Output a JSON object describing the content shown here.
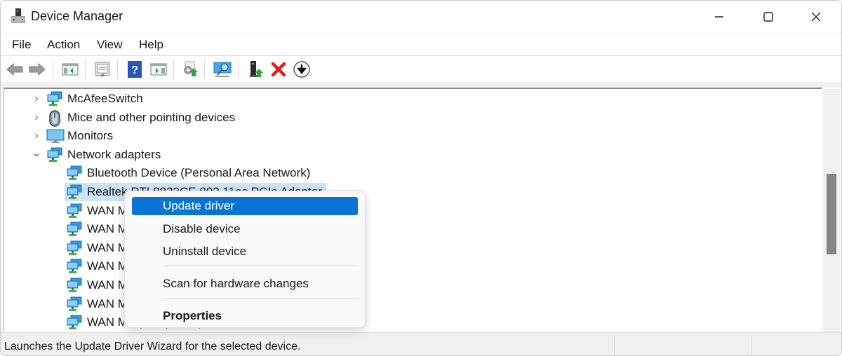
{
  "window": {
    "title": "Device Manager",
    "controls": {
      "minimize": "minimize",
      "maximize": "maximize",
      "close": "close"
    }
  },
  "menubar": {
    "items": [
      {
        "label": "File"
      },
      {
        "label": "Action"
      },
      {
        "label": "View"
      },
      {
        "label": "Help"
      }
    ]
  },
  "toolbar": {
    "buttons": [
      {
        "icon": "back-arrow-icon",
        "tooltip": "Back"
      },
      {
        "icon": "forward-arrow-icon",
        "tooltip": "Forward"
      },
      {
        "icon": "show-hide-console-tree-icon",
        "tooltip": "Show/Hide Console Tree"
      },
      {
        "icon": "properties-icon",
        "tooltip": "Properties"
      },
      {
        "icon": "help-icon",
        "tooltip": "Help"
      },
      {
        "icon": "show-hide-action-pane-icon",
        "tooltip": "Show/Hide Action Pane"
      },
      {
        "icon": "update-driver-icon",
        "tooltip": "Update Driver"
      },
      {
        "icon": "scan-hardware-icon",
        "tooltip": "Scan for hardware changes"
      },
      {
        "icon": "add-legacy-hardware-icon",
        "tooltip": "Add drivers"
      },
      {
        "icon": "uninstall-icon",
        "tooltip": "Uninstall device"
      },
      {
        "icon": "disable-device-icon",
        "tooltip": "Disable device"
      }
    ]
  },
  "tree": {
    "items": [
      {
        "label": "McAfeeSwitch",
        "level": 1,
        "expanded": false,
        "icon": "network-adapter-icon"
      },
      {
        "label": "Mice and other pointing devices",
        "level": 1,
        "expanded": false,
        "icon": "mouse-icon"
      },
      {
        "label": "Monitors",
        "level": 1,
        "expanded": false,
        "icon": "monitor-icon"
      },
      {
        "label": "Network adapters",
        "level": 1,
        "expanded": true,
        "icon": "network-adapter-icon"
      },
      {
        "label": "Bluetooth Device (Personal Area Network)",
        "level": 2,
        "icon": "network-adapter-icon"
      },
      {
        "label": "Realtek RTL8822CE 802.11ac PCIe Adapter",
        "level": 2,
        "icon": "network-adapter-icon",
        "selected": true
      },
      {
        "label": "WAN Miniport (IKEv2)",
        "level": 2,
        "icon": "network-adapter-icon"
      },
      {
        "label": "WAN Miniport (IP)",
        "level": 2,
        "icon": "network-adapter-icon"
      },
      {
        "label": "WAN Miniport (IPv6)",
        "level": 2,
        "icon": "network-adapter-icon"
      },
      {
        "label": "WAN Miniport (L2TP)",
        "level": 2,
        "icon": "network-adapter-icon"
      },
      {
        "label": "WAN Miniport (Network Monitor)",
        "level": 2,
        "icon": "network-adapter-icon"
      },
      {
        "label": "WAN Miniport (PPPOE)",
        "level": 2,
        "icon": "network-adapter-icon"
      },
      {
        "label": "WAN Miniport (PPTP)",
        "level": 2,
        "icon": "network-adapter-icon"
      }
    ]
  },
  "context_menu": {
    "items": [
      {
        "label": "Update driver",
        "highlighted": true
      },
      {
        "label": "Disable device"
      },
      {
        "label": "Uninstall device"
      },
      {
        "label": "Scan for hardware changes"
      },
      {
        "label": "Properties",
        "bold": true
      }
    ]
  },
  "scrollbar": {
    "position_fraction": 0.35,
    "visible_fraction": 0.33
  },
  "statusbar": {
    "text": "Launches the Update Driver Wizard for the selected device."
  },
  "colors": {
    "selection": "#cce4f7",
    "menu_highlight": "#0a74d4",
    "uninstall_red": "#e0201b",
    "help_blue": "#2a56b8"
  }
}
